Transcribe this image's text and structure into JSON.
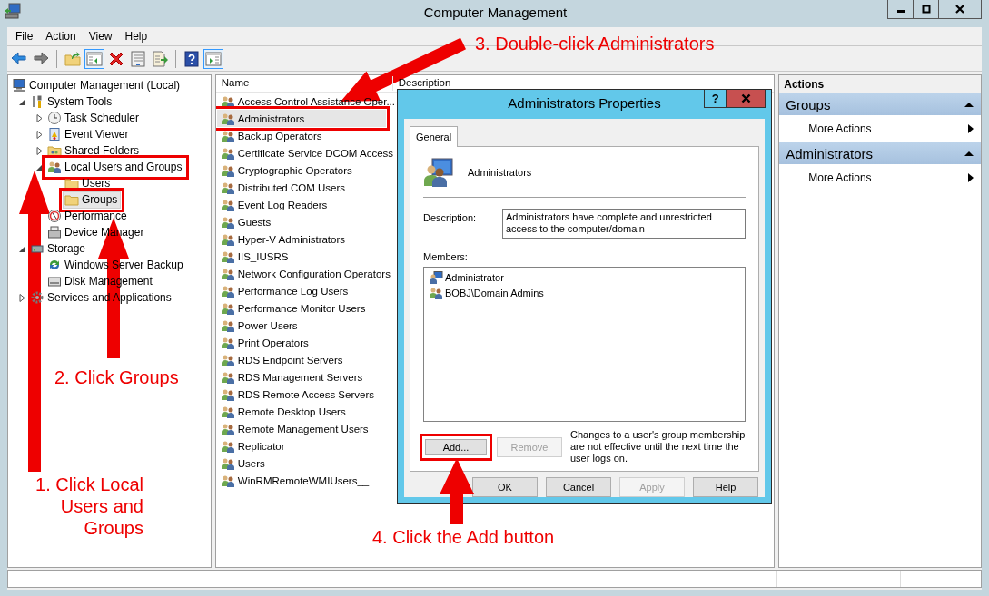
{
  "window": {
    "title": "Computer Management"
  },
  "menu": [
    "File",
    "Action",
    "View",
    "Help"
  ],
  "toolbar": [
    {
      "kind": "back",
      "on": false
    },
    {
      "kind": "forward",
      "on": false
    },
    {
      "kind": "separator"
    },
    {
      "kind": "up",
      "on": false
    },
    {
      "kind": "console-tree",
      "on": true
    },
    {
      "kind": "delete",
      "on": false
    },
    {
      "kind": "properties",
      "on": false
    },
    {
      "kind": "export",
      "on": false
    },
    {
      "kind": "separator"
    },
    {
      "kind": "help",
      "on": false
    },
    {
      "kind": "action-pane",
      "on": true
    }
  ],
  "tree": {
    "items": [
      {
        "label": "Computer Management (Local)",
        "kind": "computer",
        "selected": false,
        "annotated": false,
        "children": [
          {
            "label": "System Tools",
            "kind": "tools",
            "expanded": true,
            "selected": false,
            "annotated": false,
            "children": [
              {
                "label": "Task Scheduler",
                "kind": "clock",
                "expanded": false,
                "selected": false,
                "annotated": false
              },
              {
                "label": "Event Viewer",
                "kind": "log",
                "expanded": false,
                "selected": false,
                "annotated": false
              },
              {
                "label": "Shared Folders",
                "kind": "share",
                "expanded": false,
                "selected": false,
                "annotated": false
              },
              {
                "label": "Local Users and Groups",
                "kind": "users",
                "expanded": true,
                "selected": false,
                "annotated": true,
                "children": [
                  {
                    "label": "Users",
                    "kind": "folder",
                    "selected": false,
                    "annotated": false
                  },
                  {
                    "label": "Groups",
                    "kind": "folder",
                    "selected": true,
                    "annotated": true
                  }
                ]
              },
              {
                "label": "Performance",
                "kind": "gauge",
                "selected": false,
                "annotated": false
              },
              {
                "label": "Device Manager",
                "kind": "device",
                "selected": false,
                "annotated": false
              }
            ]
          },
          {
            "label": "Storage",
            "kind": "storage",
            "expanded": true,
            "selected": false,
            "annotated": false,
            "children": [
              {
                "label": "Windows Server Backup",
                "kind": "backup",
                "selected": false,
                "annotated": false
              },
              {
                "label": "Disk Management",
                "kind": "disk",
                "selected": false,
                "annotated": false
              }
            ]
          },
          {
            "label": "Services and Applications",
            "kind": "services",
            "expanded": false,
            "selected": false,
            "annotated": false
          }
        ]
      }
    ]
  },
  "list": {
    "columns": [
      "Name",
      "Description"
    ],
    "rows": [
      {
        "name": "Access Control Assistance Oper...",
        "selected": false,
        "annotated": false
      },
      {
        "name": "Administrators",
        "selected": true,
        "annotated": true
      },
      {
        "name": "Backup Operators",
        "selected": false,
        "annotated": false
      },
      {
        "name": "Certificate Service DCOM Access",
        "selected": false,
        "annotated": false
      },
      {
        "name": "Cryptographic Operators",
        "selected": false,
        "annotated": false
      },
      {
        "name": "Distributed COM Users",
        "selected": false,
        "annotated": false
      },
      {
        "name": "Event Log Readers",
        "selected": false,
        "annotated": false
      },
      {
        "name": "Guests",
        "selected": false,
        "annotated": false
      },
      {
        "name": "Hyper-V Administrators",
        "selected": false,
        "annotated": false
      },
      {
        "name": "IIS_IUSRS",
        "selected": false,
        "annotated": false
      },
      {
        "name": "Network Configuration Operators",
        "selected": false,
        "annotated": false
      },
      {
        "name": "Performance Log Users",
        "selected": false,
        "annotated": false
      },
      {
        "name": "Performance Monitor Users",
        "selected": false,
        "annotated": false
      },
      {
        "name": "Power Users",
        "selected": false,
        "annotated": false
      },
      {
        "name": "Print Operators",
        "selected": false,
        "annotated": false
      },
      {
        "name": "RDS Endpoint Servers",
        "selected": false,
        "annotated": false
      },
      {
        "name": "RDS Management Servers",
        "selected": false,
        "annotated": false
      },
      {
        "name": "RDS Remote Access Servers",
        "selected": false,
        "annotated": false
      },
      {
        "name": "Remote Desktop Users",
        "selected": false,
        "annotated": false
      },
      {
        "name": "Remote Management Users",
        "selected": false,
        "annotated": false
      },
      {
        "name": "Replicator",
        "selected": false,
        "annotated": false
      },
      {
        "name": "Users",
        "selected": false,
        "annotated": false
      },
      {
        "name": "WinRMRemoteWMIUsers__",
        "selected": false,
        "annotated": false
      }
    ]
  },
  "actions": {
    "title": "Actions",
    "sections": [
      {
        "title": "Groups",
        "expanded": true,
        "items": [
          "More Actions"
        ]
      },
      {
        "title": "Administrators",
        "expanded": true,
        "items": [
          "More Actions"
        ]
      }
    ]
  },
  "dialog": {
    "title": "Administrators Properties",
    "help_button": "?",
    "tabs": [
      {
        "label": "General",
        "selected": true
      }
    ],
    "group_name": "Administrators",
    "description_label": "Description:",
    "description": "Administrators have complete and unrestricted access to the computer/domain",
    "members_label": "Members:",
    "members": [
      {
        "name": "Administrator",
        "kind": "user"
      },
      {
        "name": "BOBJ\\Domain Admins",
        "kind": "group"
      }
    ],
    "buttons": [
      {
        "label": "Add...",
        "disabled": false,
        "annotated": true
      },
      {
        "label": "Remove",
        "disabled": true,
        "annotated": false
      }
    ],
    "note": "Changes to a user's group membership are not effective until the next time the user logs on.",
    "footer_buttons": [
      {
        "label": "OK",
        "disabled": false
      },
      {
        "label": "Cancel",
        "disabled": false
      },
      {
        "label": "Apply",
        "disabled": true
      },
      {
        "label": "Help",
        "disabled": false
      }
    ]
  },
  "annotations": [
    {
      "text": "3. Double-click Administrators"
    },
    {
      "text": "2. Click Groups"
    },
    {
      "text": "1. Click Local\nUsers and\nGroups"
    },
    {
      "text": "4. Click the Add button"
    }
  ]
}
